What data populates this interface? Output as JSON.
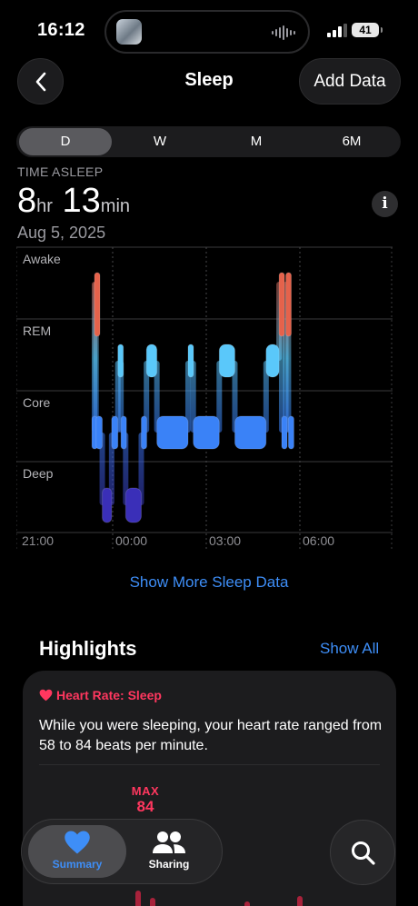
{
  "status": {
    "time": "16:12",
    "battery": "41"
  },
  "nav": {
    "title": "Sleep",
    "add_data": "Add Data"
  },
  "segments": [
    "D",
    "W",
    "M",
    "6M"
  ],
  "summary": {
    "label": "TIME ASLEEP",
    "hours": "8",
    "hr_unit": "hr",
    "minutes": "13",
    "min_unit": "min",
    "date": "Aug 5, 2025"
  },
  "chart_data": {
    "type": "hypnogram",
    "stages": [
      "Awake",
      "REM",
      "Core",
      "Deep"
    ],
    "ticks": [
      "21:00",
      "00:00",
      "03:00",
      "06:00"
    ],
    "colors": {
      "Awake": "#e5624b",
      "REM": "#5ac8fa",
      "Core": "#3a82f7",
      "Deep": "#3a2fb8"
    },
    "start": "21:00",
    "segments": [
      {
        "stage": "Core",
        "start": "23:20",
        "end": "23:25"
      },
      {
        "stage": "Awake",
        "start": "23:25",
        "end": "23:28"
      },
      {
        "stage": "Core",
        "start": "23:28",
        "end": "23:40"
      },
      {
        "stage": "Deep",
        "start": "23:40",
        "end": "23:58"
      },
      {
        "stage": "Core",
        "start": "23:58",
        "end": "00:10"
      },
      {
        "stage": "REM",
        "start": "00:10",
        "end": "00:16"
      },
      {
        "stage": "Core",
        "start": "00:16",
        "end": "00:25"
      },
      {
        "stage": "Deep",
        "start": "00:25",
        "end": "00:55"
      },
      {
        "stage": "Core",
        "start": "00:55",
        "end": "01:05"
      },
      {
        "stage": "REM",
        "start": "01:05",
        "end": "01:25"
      },
      {
        "stage": "Core",
        "start": "01:25",
        "end": "02:25"
      },
      {
        "stage": "REM",
        "start": "02:25",
        "end": "02:35"
      },
      {
        "stage": "Core",
        "start": "02:35",
        "end": "03:25"
      },
      {
        "stage": "REM",
        "start": "03:25",
        "end": "03:55"
      },
      {
        "stage": "Core",
        "start": "03:55",
        "end": "04:55"
      },
      {
        "stage": "REM",
        "start": "04:55",
        "end": "05:20"
      },
      {
        "stage": "Awake",
        "start": "05:20",
        "end": "05:25"
      },
      {
        "stage": "Core",
        "start": "05:25",
        "end": "05:33"
      },
      {
        "stage": "Awake",
        "start": "05:33",
        "end": "05:38"
      },
      {
        "stage": "Core",
        "start": "05:38",
        "end": "05:48"
      }
    ]
  },
  "more_link": "Show More Sleep Data",
  "highlights": {
    "title": "Highlights",
    "show_all": "Show All",
    "card": {
      "title": "Heart Rate: Sleep",
      "text": "While you were sleeping, your heart rate ranged from 58 to 84 beats per minute.",
      "max_label": "MAX",
      "max_value": "84"
    }
  },
  "tabs": {
    "summary": "Summary",
    "sharing": "Sharing"
  }
}
